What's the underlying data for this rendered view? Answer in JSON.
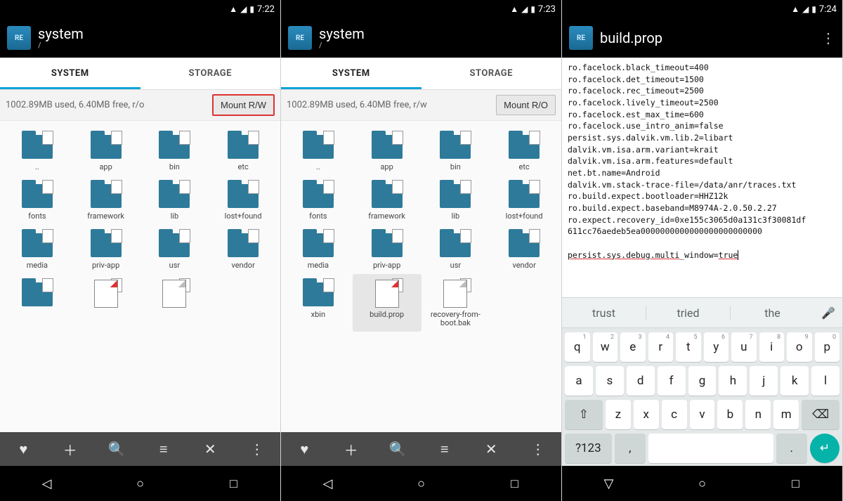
{
  "phones": [
    {
      "time": "7:22",
      "title": "system",
      "path": "/",
      "tabs": [
        "SYSTEM",
        "STORAGE"
      ],
      "active_tab": 0,
      "info": "1002.89MB used, 6.40MB free, r/o",
      "mount_label": "Mount R/W",
      "mount_red": true,
      "items": [
        {
          "name": "..",
          "type": "folder"
        },
        {
          "name": "app",
          "type": "folder"
        },
        {
          "name": "bin",
          "type": "folder"
        },
        {
          "name": "etc",
          "type": "folder"
        },
        {
          "name": "fonts",
          "type": "folder"
        },
        {
          "name": "framework",
          "type": "folder"
        },
        {
          "name": "lib",
          "type": "folder"
        },
        {
          "name": "lost+found",
          "type": "folder"
        },
        {
          "name": "media",
          "type": "folder"
        },
        {
          "name": "priv-app",
          "type": "folder"
        },
        {
          "name": "usr",
          "type": "folder"
        },
        {
          "name": "vendor",
          "type": "folder"
        },
        {
          "name": "",
          "type": "folder"
        },
        {
          "name": "",
          "type": "file"
        },
        {
          "name": "",
          "type": "file-blank"
        }
      ]
    },
    {
      "time": "7:23",
      "title": "system",
      "path": "/",
      "tabs": [
        "SYSTEM",
        "STORAGE"
      ],
      "active_tab": 0,
      "info": "1002.89MB used, 6.40MB free, r/w",
      "mount_label": "Mount R/O",
      "mount_red": false,
      "items": [
        {
          "name": "..",
          "type": "folder"
        },
        {
          "name": "app",
          "type": "folder"
        },
        {
          "name": "bin",
          "type": "folder"
        },
        {
          "name": "etc",
          "type": "folder"
        },
        {
          "name": "fonts",
          "type": "folder"
        },
        {
          "name": "framework",
          "type": "folder"
        },
        {
          "name": "lib",
          "type": "folder"
        },
        {
          "name": "lost+found",
          "type": "folder"
        },
        {
          "name": "media",
          "type": "folder"
        },
        {
          "name": "priv-app",
          "type": "folder"
        },
        {
          "name": "usr",
          "type": "folder"
        },
        {
          "name": "vendor",
          "type": "folder"
        },
        {
          "name": "xbin",
          "type": "folder"
        },
        {
          "name": "build.prop",
          "type": "file",
          "selected": true
        },
        {
          "name": "recovery-from-boot.bak",
          "type": "file-blank"
        }
      ]
    },
    {
      "time": "7:24",
      "title": "build.prop",
      "editor_lines": [
        "ro.facelock.black_timeout=400",
        "ro.facelock.det_timeout=1500",
        "ro.facelock.rec_timeout=2500",
        "ro.facelock.lively_timeout=2500",
        "ro.facelock.est_max_time=600",
        "ro.facelock.use_intro_anim=false",
        "persist.sys.dalvik.vm.lib.2=libart",
        "dalvik.vm.isa.arm.variant=krait",
        "dalvik.vm.isa.arm.features=default",
        "net.bt.name=Android",
        "dalvik.vm.stack-trace-file=/data/anr/traces.txt",
        "ro.build.expect.bootloader=HHZ12k",
        "ro.build.expect.baseband=M8974A-2.0.50.2.27",
        "ro.expect.recovery_id=0xe155c3065d0a131c3f30081df",
        "611cc76aedeb5ea0000000000000000000000000"
      ],
      "editor_insert": {
        "underlined": "persist.sys.debug.multi",
        "rest": "_window=",
        "tail": "true"
      },
      "suggestions": [
        "trust",
        "tried",
        "the"
      ],
      "kbd_rows": [
        [
          {
            "k": "q",
            "n": "1"
          },
          {
            "k": "w",
            "n": "2"
          },
          {
            "k": "e",
            "n": "3"
          },
          {
            "k": "r",
            "n": "4"
          },
          {
            "k": "t",
            "n": "5"
          },
          {
            "k": "y",
            "n": "6"
          },
          {
            "k": "u",
            "n": "7"
          },
          {
            "k": "i",
            "n": "8"
          },
          {
            "k": "o",
            "n": "9"
          },
          {
            "k": "p",
            "n": "0"
          }
        ],
        [
          {
            "k": "a"
          },
          {
            "k": "s"
          },
          {
            "k": "d"
          },
          {
            "k": "f"
          },
          {
            "k": "g"
          },
          {
            "k": "h"
          },
          {
            "k": "j"
          },
          {
            "k": "k"
          },
          {
            "k": "l"
          }
        ],
        [
          {
            "k": "⇧",
            "cls": "func wide"
          },
          {
            "k": "z"
          },
          {
            "k": "x"
          },
          {
            "k": "c"
          },
          {
            "k": "v"
          },
          {
            "k": "b"
          },
          {
            "k": "n"
          },
          {
            "k": "m"
          },
          {
            "k": "⌫",
            "cls": "func wide"
          }
        ],
        [
          {
            "k": "?123",
            "cls": "func wide"
          },
          {
            "k": ",",
            "cls": "func"
          },
          {
            "k": "",
            "cls": "space"
          },
          {
            "k": ".",
            "cls": "func"
          },
          {
            "k": "↵",
            "cls": "enter"
          }
        ]
      ]
    }
  ],
  "toolbar_icons": [
    "♥",
    "＋",
    "🔍",
    "≡",
    "✕",
    "⋮"
  ],
  "nav_icons": [
    "◁",
    "○",
    "□"
  ],
  "nav_icons_kbd": [
    "▽",
    "○",
    "□"
  ]
}
